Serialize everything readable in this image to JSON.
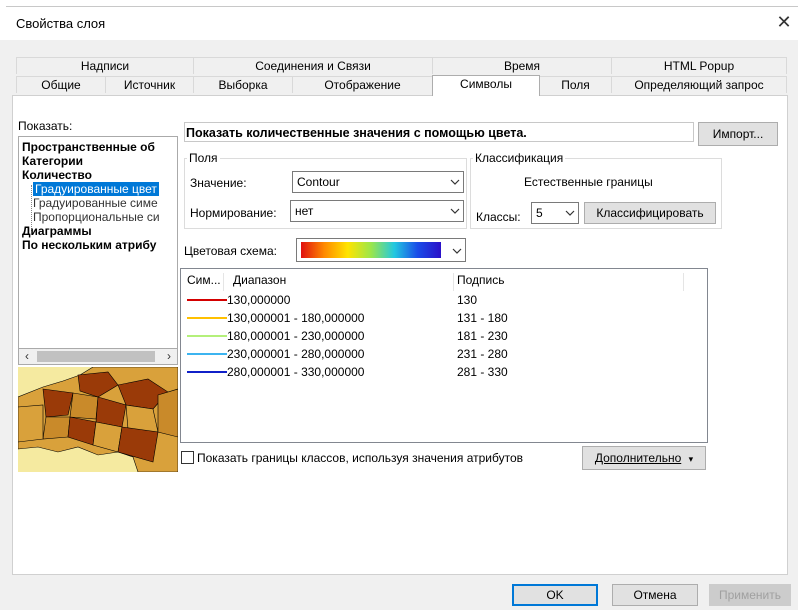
{
  "window": {
    "title": "Свойства слоя",
    "close_glyph": "✕"
  },
  "tabs_row1": [
    {
      "label": "Надписи"
    },
    {
      "label": "Соединения и Связи"
    },
    {
      "label": "Время"
    },
    {
      "label": "HTML Popup"
    }
  ],
  "tabs_row2": [
    {
      "label": "Общие"
    },
    {
      "label": "Источник"
    },
    {
      "label": "Выборка"
    },
    {
      "label": "Отображение"
    },
    {
      "label": "Символы",
      "active": true
    },
    {
      "label": "Поля"
    },
    {
      "label": "Определяющий запрос"
    }
  ],
  "show_label": "Показать:",
  "tree": {
    "items": [
      {
        "label": "Пространственные об",
        "bold": true
      },
      {
        "label": "Категории",
        "bold": true
      },
      {
        "label": "Количество",
        "bold": true
      },
      {
        "label": "Градуированные цвет",
        "child": true,
        "selected": true
      },
      {
        "label": "Градуированные симе",
        "child": true
      },
      {
        "label": "Пропорциональные си",
        "child": true
      },
      {
        "label": "Диаграммы",
        "bold": true
      },
      {
        "label": "По нескольким атрибу",
        "bold": true
      }
    ]
  },
  "scroll": {
    "left_arrow": "‹",
    "right_arrow": "›"
  },
  "header": {
    "text": "Показать количественные значения с помощью цвета.",
    "import_button": "Импорт..."
  },
  "fields_group": {
    "legend": "Поля",
    "value_label": "Значение:",
    "value": "Contour",
    "norm_label": "Нормирование:",
    "norm_value": "нет"
  },
  "class_group": {
    "legend": "Классификация",
    "method": "Естественные границы",
    "classes_label": "Классы:",
    "classes_value": "5",
    "classify_button": "Классифицировать"
  },
  "color_scheme_label": "Цветовая схема:",
  "listview": {
    "headers": {
      "symbol": "Сим...",
      "range": "Диапазон",
      "label": "Подпись"
    },
    "rows": [
      {
        "range": "130,000000",
        "label": "130",
        "color": "#d40000"
      },
      {
        "range": "130,000001 - 180,000000",
        "label": "131 - 180",
        "color": "#ffc000"
      },
      {
        "range": "180,000001 - 230,000000",
        "label": "181 - 230",
        "color": "#b4f07a"
      },
      {
        "range": "230,000001 - 280,000000",
        "label": "231 - 280",
        "color": "#3cb4f0"
      },
      {
        "range": "280,000001 - 330,000000",
        "label": "281 - 330",
        "color": "#1020c8"
      }
    ]
  },
  "show_class_bounds": "Показать границы классов, используя значения атрибутов",
  "advanced_button": "Дополнительно",
  "footer": {
    "ok": "OK",
    "cancel": "Отмена",
    "apply": "Применить"
  }
}
